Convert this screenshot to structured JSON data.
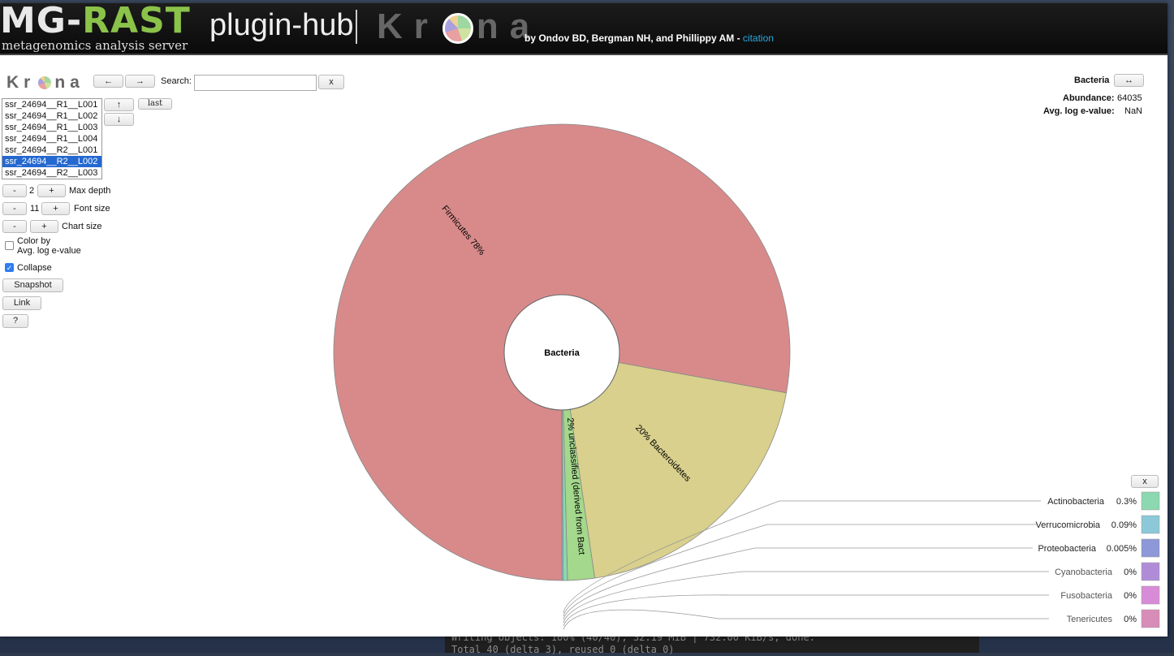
{
  "terminal": {
    "line1": "Writing objects: 100% (40/40), 32.19 MiB | 732.00 KiB/s, done.",
    "line2": "Total 40 (delta 3), reused 0 (delta 0)"
  },
  "header": {
    "logo_mg": "MG-",
    "logo_rast": "RAST",
    "logo_subtitle": "metagenomics analysis server",
    "plugin_hub": "plugin-hub",
    "krona_k": "Kr",
    "krona_rest": "na",
    "byline": "by Ondov BD, Bergman NH, and Phillippy AM - ",
    "citation": "citation"
  },
  "toolbar": {
    "krona_k": "Kr",
    "krona_rest": "na",
    "back": "←",
    "forward": "→",
    "search_label": "Search:",
    "search_value": "",
    "search_clear": "x",
    "up": "↑",
    "down": "↓",
    "last": "last"
  },
  "datasets": {
    "items": [
      "ssr_24694__R1__L001",
      "ssr_24694__R1__L002",
      "ssr_24694__R1__L003",
      "ssr_24694__R1__L004",
      "ssr_24694__R2__L001",
      "ssr_24694__R2__L002",
      "ssr_24694__R2__L003"
    ],
    "selected_index": 5
  },
  "controls": {
    "minus": "-",
    "plus": "+",
    "max_depth_value": "2",
    "max_depth_label": "Max depth",
    "font_size_value": "11",
    "font_size_label": "Font size",
    "chart_size_label": "Chart size",
    "color_by_label_1": "Color by",
    "color_by_label_2": "Avg. log e-value",
    "color_by_checked": false,
    "collapse_label": "Collapse",
    "collapse_checked": true,
    "snapshot": "Snapshot",
    "link": "Link",
    "help": "?"
  },
  "details": {
    "name": "Bacteria",
    "expand_icon": "↔",
    "abundance_label": "Abundance:",
    "abundance_value": "64035",
    "evalue_label": "Avg. log e-value:",
    "evalue_value": "NaN"
  },
  "chart_data": {
    "type": "pie",
    "center_label": "Bacteria",
    "slices": [
      {
        "name": "Firmicutes",
        "label": "Firmicutes 78%",
        "percent": 77.6,
        "color": "#d88a8a"
      },
      {
        "name": "Bacteroidetes",
        "label": "20% Bacteroidetes",
        "percent": 19.8,
        "color": "#d8d08c"
      },
      {
        "name": "unclassified (derived from Bacteria)",
        "label": "2% unclassified (derived from Bact",
        "percent": 1.9,
        "color": "#a4d88c"
      },
      {
        "name": "Actinobacteria",
        "percent": 0.3,
        "color": "#8cd8b0"
      },
      {
        "name": "Verrucomicrobia",
        "percent": 0.09,
        "color": "#8cc8d8"
      },
      {
        "name": "Proteobacteria",
        "percent": 0.005,
        "color": "#8c98d8"
      },
      {
        "name": "Cyanobacteria",
        "percent": 0,
        "color": "#b08cd8"
      },
      {
        "name": "Fusobacteria",
        "percent": 0,
        "color": "#d88cd8"
      },
      {
        "name": "Tenericutes",
        "percent": 0,
        "color": "#d88cb8"
      }
    ],
    "small_legend": [
      {
        "name": "Actinobacteria",
        "pct": "0.3%",
        "color": "#8cd8b0"
      },
      {
        "name": "Verrucomicrobia",
        "pct": "0.09%",
        "color": "#8cc8d8"
      },
      {
        "name": "Proteobacteria",
        "pct": "0.005%",
        "color": "#8c98d8"
      },
      {
        "name": "Cyanobacteria",
        "pct": "0%",
        "color": "#b08cd8"
      },
      {
        "name": "Fusobacteria",
        "pct": "0%",
        "color": "#d88cd8"
      },
      {
        "name": "Tenericutes",
        "pct": "0%",
        "color": "#d88cb8"
      }
    ],
    "legend_close": "x"
  }
}
